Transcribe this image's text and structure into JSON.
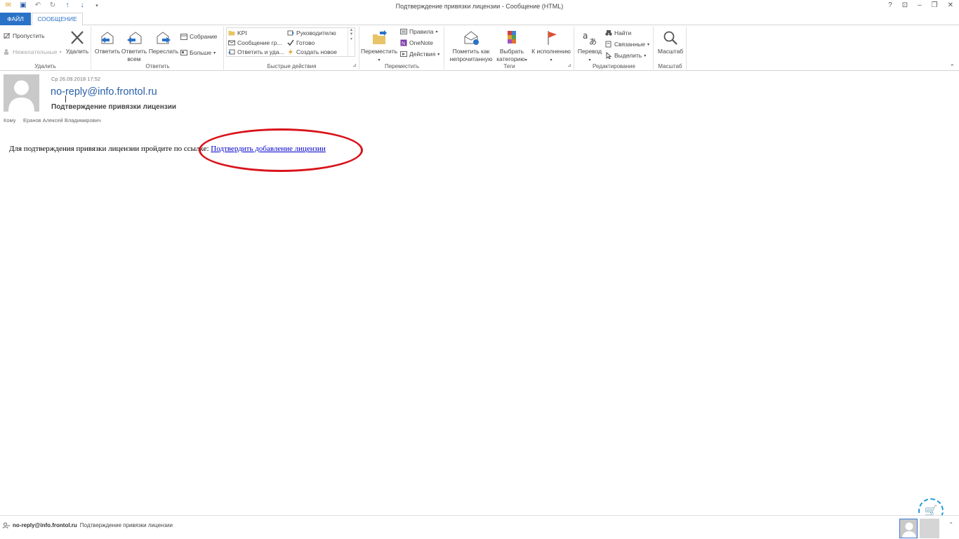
{
  "window": {
    "title": "Подтверждение привязки лицензии - Сообщение (HTML)",
    "controls": [
      "?",
      "⊡",
      "–",
      "❐",
      "✕"
    ]
  },
  "tabs": {
    "file": "ФАЙЛ",
    "message": "СООБЩЕНИЕ"
  },
  "ribbon": {
    "delete_group": {
      "label": "Удалить",
      "ignore": "Пропустить",
      "junk": "Нежелательные",
      "delete": "Удалить"
    },
    "reply_group": {
      "label": "Ответить",
      "reply": "Ответить",
      "reply_all_1": "Ответить",
      "reply_all_2": "всем",
      "forward": "Переслать",
      "meeting": "Собрание",
      "more": "Больше"
    },
    "quick_group": {
      "label": "Быстрые действия",
      "items": [
        "KPI",
        "Сообщение гр...",
        "Ответить и уда...",
        "Руководителю",
        "Готово",
        "Создать новое"
      ]
    },
    "move_group": {
      "label": "Переместить",
      "move": "Переместить",
      "rules": "Правила",
      "onenote": "OneNote",
      "actions": "Действия"
    },
    "tags_group": {
      "label": "Теги",
      "mark_unread_1": "Пометить как",
      "mark_unread_2": "непрочитанную",
      "categorize_1": "Выбрать",
      "categorize_2": "категорию",
      "followup": "К исполнению"
    },
    "edit_group": {
      "label": "Редактирование",
      "translate": "Перевод",
      "find": "Найти",
      "related": "Связанные",
      "select": "Выделить"
    },
    "zoom_group": {
      "label": "Масштаб",
      "zoom": "Масштаб"
    }
  },
  "message": {
    "date": "Ср 26.09.2018 17:52",
    "from": "no-reply@info.frontol.ru",
    "subject": "Подтверждение привязки лицензии",
    "to_label": "Кому",
    "to": "Еранов Алексей Владимирович",
    "body_text": "Для подтверждения привязки лицензии пройдите по ссылке: ",
    "link_text": "Подтвердить добавление лицензии"
  },
  "status": {
    "sender": "no-reply@info.frontol.ru",
    "subject": "Подтверждение привязки лицензии"
  },
  "colors": {
    "accent": "#2a72c8",
    "highlight_ellipse": "#d9141c",
    "link": "#0000cc"
  }
}
